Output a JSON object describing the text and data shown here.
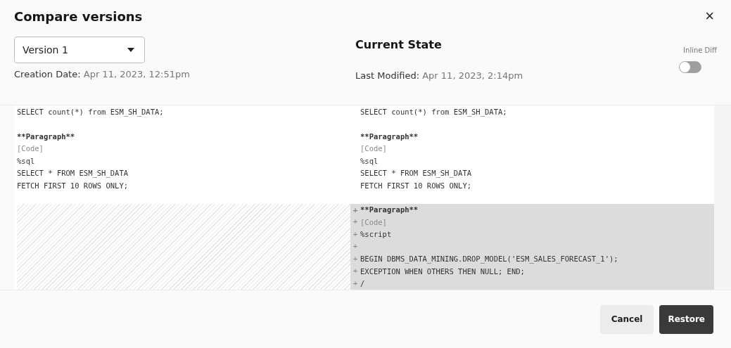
{
  "dialog": {
    "title": "Compare versions",
    "close": "×"
  },
  "version_select": {
    "value": "Version 1"
  },
  "creation": {
    "label": "Creation Date:",
    "value": "Apr 11, 2023, 12:51pm"
  },
  "current": {
    "title": "Current State",
    "label": "Last Modified:",
    "value": "Apr 11, 2023, 2:14pm"
  },
  "inline_diff": {
    "label": "Inline Diff",
    "on": false
  },
  "left_lines": [
    {
      "text": "SELECT count(*) from ESM_SH_DATA;",
      "kind": "plain"
    },
    {
      "kind": "blank"
    },
    {
      "text": "**Paragraph**",
      "kind": "bold"
    },
    {
      "text": "[Code]",
      "kind": "muted"
    },
    {
      "text": "%sql",
      "kind": "plain"
    },
    {
      "text": "SELECT * FROM ESM_SH_DATA",
      "kind": "plain"
    },
    {
      "text": "FETCH FIRST 10 ROWS ONLY;",
      "kind": "plain"
    },
    {
      "kind": "blank"
    }
  ],
  "right_lines": [
    {
      "text": "SELECT count(*) from ESM_SH_DATA;",
      "kind": "plain",
      "added": false
    },
    {
      "kind": "blank",
      "added": false
    },
    {
      "text": "**Paragraph**",
      "kind": "bold",
      "added": false
    },
    {
      "text": "[Code]",
      "kind": "muted",
      "added": false
    },
    {
      "text": "%sql",
      "kind": "plain",
      "added": false
    },
    {
      "text": "SELECT * FROM ESM_SH_DATA",
      "kind": "plain",
      "added": false
    },
    {
      "text": "FETCH FIRST 10 ROWS ONLY;",
      "kind": "plain",
      "added": false
    },
    {
      "kind": "blank",
      "added": false
    },
    {
      "text": "**Paragraph**",
      "kind": "bold",
      "added": true,
      "mark": "+"
    },
    {
      "text": "[Code]",
      "kind": "muted",
      "added": true,
      "mark": "+"
    },
    {
      "text": "%script",
      "kind": "plain",
      "added": true,
      "mark": "+"
    },
    {
      "kind": "blank",
      "added": true,
      "mark": "+"
    },
    {
      "text": "BEGIN DBMS_DATA_MINING.DROP_MODEL('ESM_SALES_FORECAST_1');",
      "kind": "plain",
      "added": true,
      "mark": "+"
    },
    {
      "text": "EXCEPTION WHEN OTHERS THEN NULL; END;",
      "kind": "plain",
      "added": true,
      "mark": "+"
    },
    {
      "text": "/",
      "kind": "plain",
      "added": true,
      "mark": "+"
    }
  ],
  "buttons": [
    {
      "label": "Cancel",
      "kind": "secondary"
    },
    {
      "label": "Restore",
      "kind": "primary"
    }
  ]
}
